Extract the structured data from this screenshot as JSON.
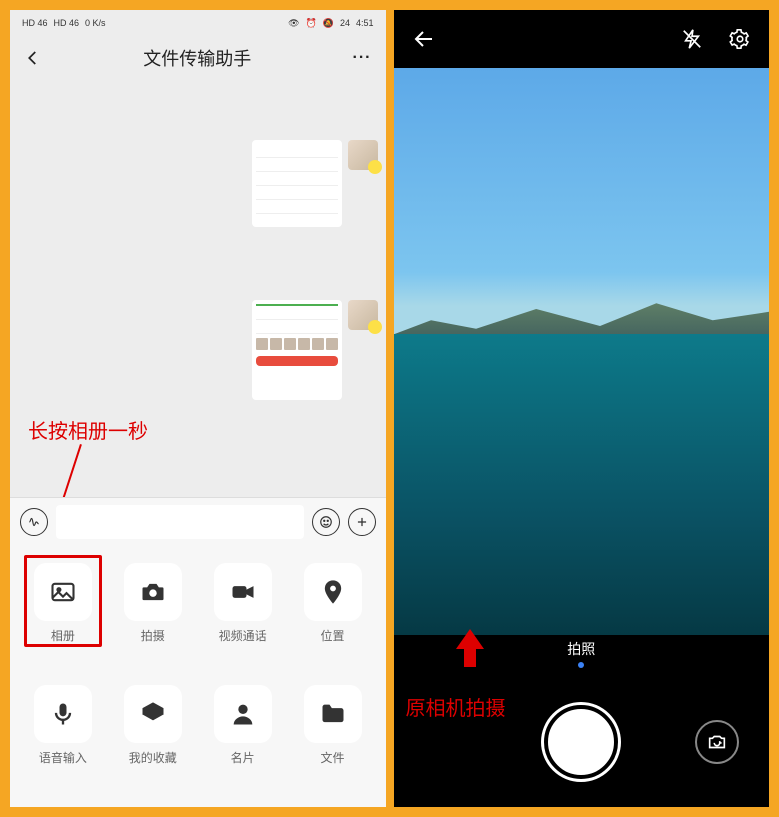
{
  "statusbar": {
    "signal1": "HD 46",
    "signal2": "HD 46",
    "kbs": "0 K/s",
    "battery": "24",
    "time": "4:51"
  },
  "wechat": {
    "header_title": "文件传输助手",
    "grid": [
      {
        "label": "相册",
        "icon": "image-icon"
      },
      {
        "label": "拍摄",
        "icon": "camera-icon"
      },
      {
        "label": "视频通话",
        "icon": "video-icon"
      },
      {
        "label": "位置",
        "icon": "location-icon"
      },
      {
        "label": "语音输入",
        "icon": "mic-icon"
      },
      {
        "label": "我的收藏",
        "icon": "bookmark-icon"
      },
      {
        "label": "名片",
        "icon": "person-icon"
      },
      {
        "label": "文件",
        "icon": "folder-icon"
      }
    ]
  },
  "annotation": {
    "left_text": "长按相册一秒",
    "right_text": "原相机拍摄"
  },
  "camera": {
    "mode_label": "拍照"
  }
}
